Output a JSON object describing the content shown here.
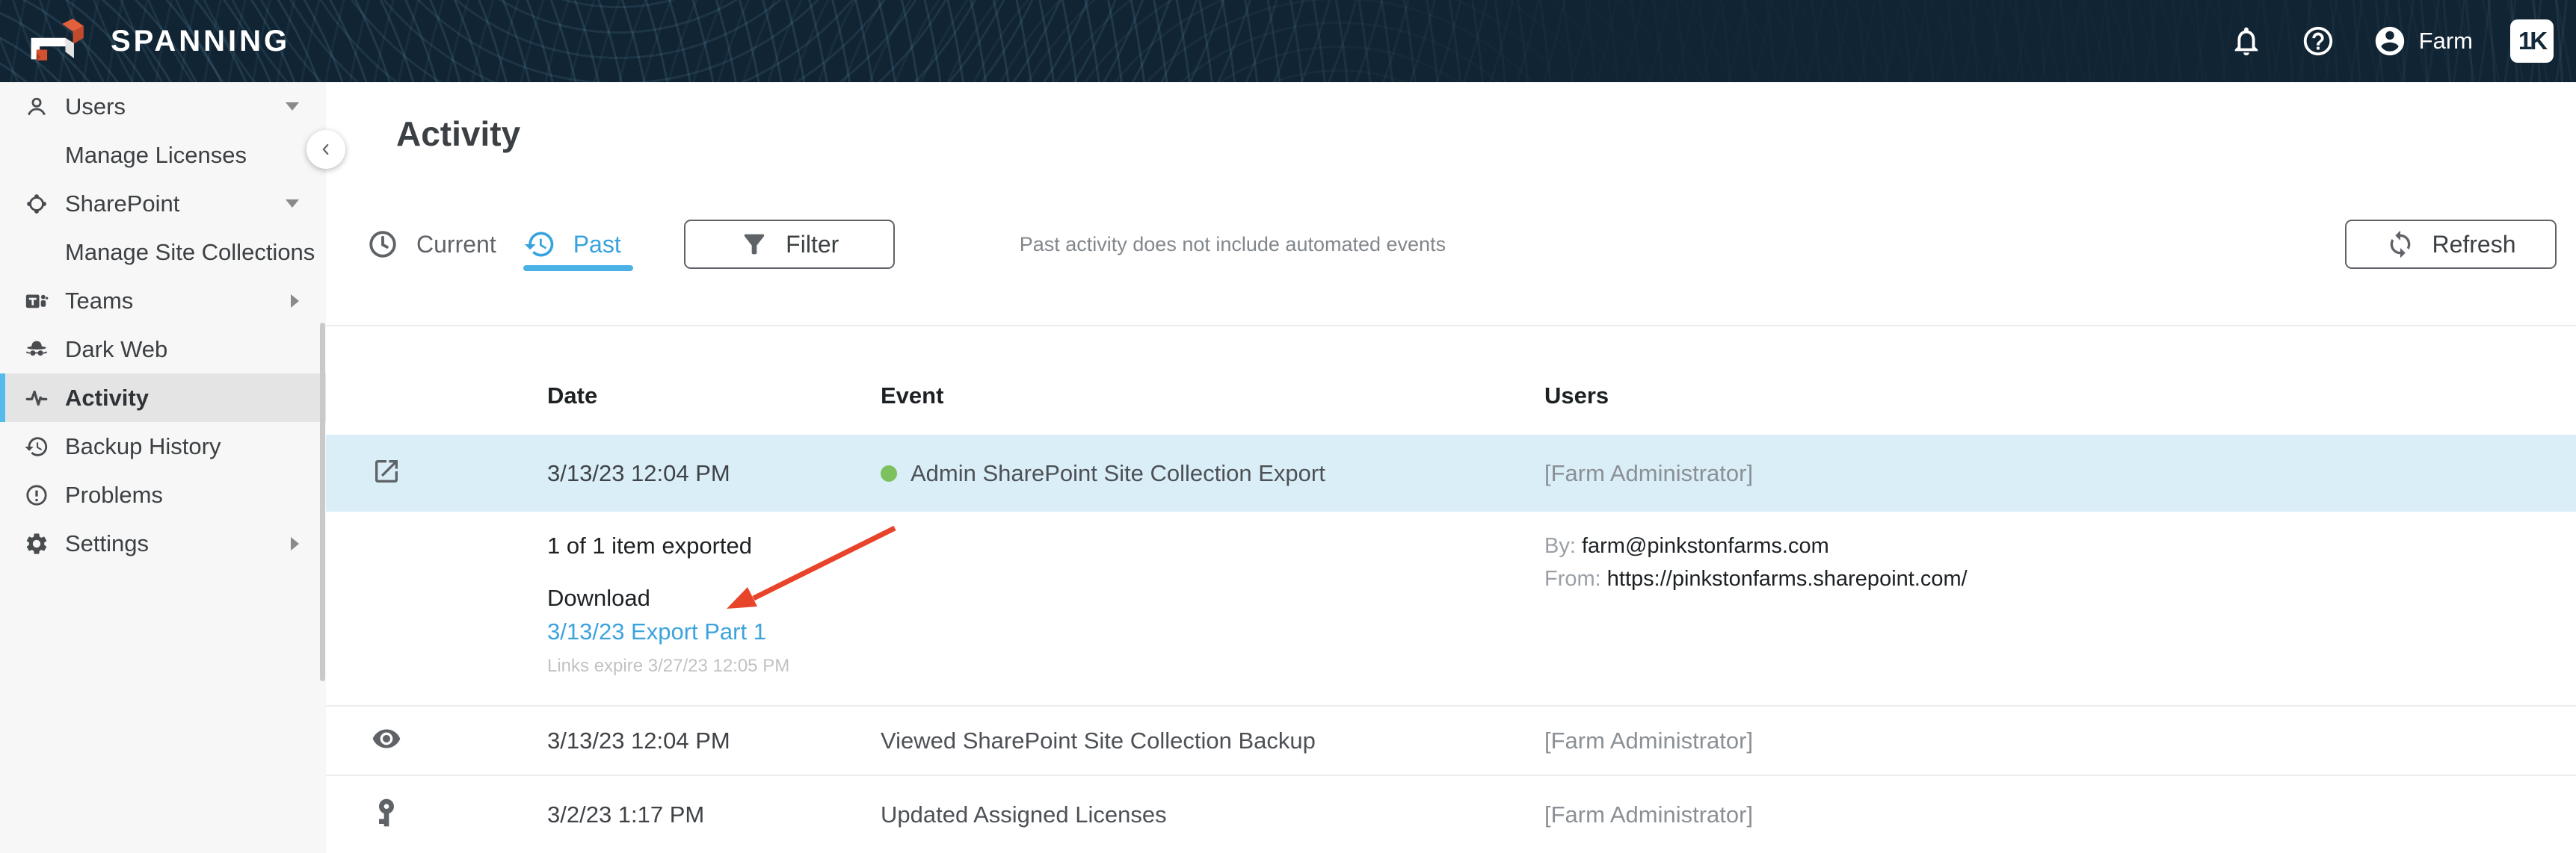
{
  "colors": {
    "header_bg": "#112433",
    "accent_blue": "#36a3de",
    "selected_bar_blue": "#55bbeb",
    "row_highlight": "#daeef8",
    "status_green": "#7cc15e",
    "annotation_red": "#e8442a"
  },
  "header": {
    "brand": "SPANNING",
    "account_label": "Farm",
    "kaseya_badge": "1K",
    "icons": [
      "spanning-logo-icon",
      "bell-icon",
      "help-icon",
      "account-icon",
      "kaseya-logo"
    ]
  },
  "sidebar": {
    "items": [
      {
        "label": "Users",
        "icon": "user-icon",
        "caret": "down"
      },
      {
        "label": "Manage Licenses",
        "child": true
      },
      {
        "label": "SharePoint",
        "icon": "sharepoint-icon",
        "caret": "down"
      },
      {
        "label": "Manage Site Collections",
        "child": true
      },
      {
        "label": "Teams",
        "icon": "teams-icon",
        "caret": "right"
      },
      {
        "label": "Dark Web",
        "icon": "spy-icon"
      },
      {
        "label": "Activity",
        "icon": "pulse-icon",
        "selected": true
      },
      {
        "label": "Backup History",
        "icon": "history-icon"
      },
      {
        "label": "Problems",
        "icon": "alert-circle-icon"
      },
      {
        "label": "Settings",
        "icon": "gear-icon",
        "caret": "right"
      }
    ]
  },
  "main": {
    "title": "Activity",
    "tabs": [
      {
        "label": "Current",
        "icon": "clock-icon",
        "active": false
      },
      {
        "label": "Past",
        "icon": "history-icon",
        "active": true
      }
    ],
    "filter_label": "Filter",
    "note": "Past activity does not include automated events",
    "refresh_label": "Refresh",
    "table": {
      "columns": [
        "Date",
        "Event",
        "Users"
      ],
      "rows": [
        {
          "icon": "export-icon",
          "date": "3/13/23 12:04 PM",
          "event": "Admin SharePoint Site Collection Export",
          "status_dot": true,
          "users": "[Farm Administrator]",
          "highlighted": true
        },
        {
          "icon": "eye-icon",
          "date": "3/13/23 12:04 PM",
          "event": "Viewed SharePoint Site Collection Backup",
          "users": "[Farm Administrator]"
        },
        {
          "icon": "key-icon",
          "date": "3/2/23 1:17 PM",
          "event": "Updated Assigned Licenses",
          "users": "[Farm Administrator]"
        }
      ],
      "expanded_detail": {
        "summary": "1 of 1 item exported",
        "download_label": "Download",
        "download_link": "3/13/23 Export Part 1",
        "expiry_note": "Links expire 3/27/23 12:05 PM",
        "by_label": "By:",
        "by_value": "farm@pinkstonfarms.com",
        "from_label": "From:",
        "from_value": "https://pinkstonfarms.sharepoint.com/"
      }
    }
  }
}
